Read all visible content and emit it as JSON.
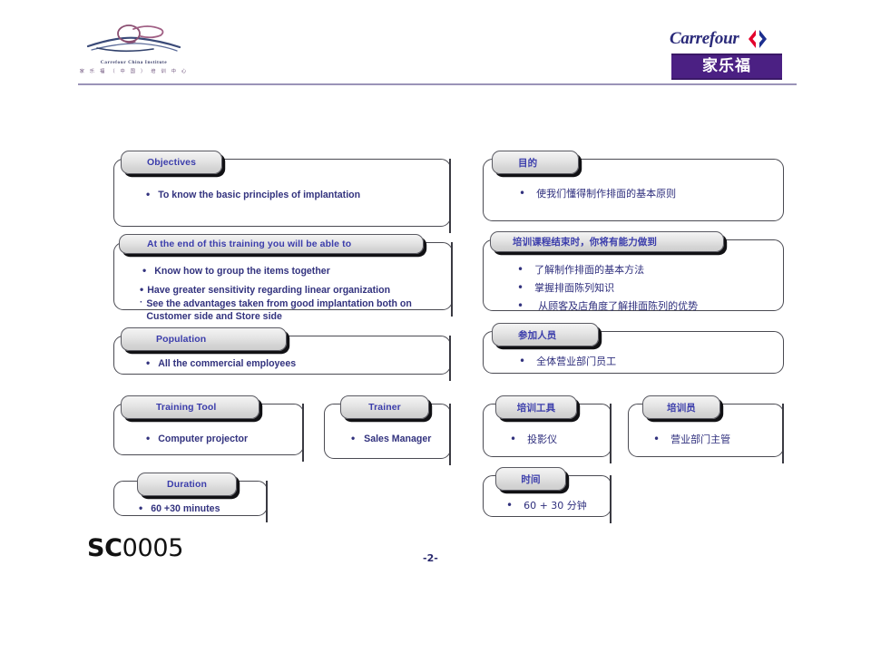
{
  "header": {
    "institute_logo": {
      "name_en": "Carrefour China Institute",
      "name_cn": "家 乐 福 （ 中 国 ） 培 训 中 心",
      "icon": "hand-holding-seedling-icon"
    },
    "carrefour_logo": {
      "wordmark": "Carrefour",
      "mark_icon": "carrefour-chevron-icon",
      "chinese_name": "家乐福"
    }
  },
  "left_column": [
    {
      "id": "objectives",
      "tab": "Objectives",
      "items": [
        "To know the basic principles of implantation"
      ]
    },
    {
      "id": "able-to",
      "tab": "At the end of this training you will be able to",
      "items": [
        "Know how to group the items together",
        "Have greater sensitivity regarding linear organization",
        "See the advantages taken from good implantation both on Customer side and Store side"
      ]
    },
    {
      "id": "population",
      "tab": "Population",
      "items": [
        "All the commercial employees"
      ]
    },
    {
      "id": "training-tool",
      "tab": "Training Tool",
      "items": [
        "Computer projector"
      ]
    },
    {
      "id": "trainer",
      "tab": "Trainer",
      "items": [
        "Sales Manager"
      ]
    },
    {
      "id": "duration",
      "tab": "Duration",
      "items": [
        "60 +30 minutes"
      ]
    }
  ],
  "right_column": [
    {
      "id": "objectives-cn",
      "tab": "目的",
      "items": [
        "使我们懂得制作排面的基本原则"
      ]
    },
    {
      "id": "able-to-cn",
      "tab": "培训课程结束时，你将有能力做到",
      "items": [
        "了解制作排面的基本方法",
        "掌握排面陈列知识",
        "从顾客及店角度了解排面陈列的优势"
      ]
    },
    {
      "id": "population-cn",
      "tab": "参加人员",
      "items": [
        "全体营业部门员工"
      ]
    },
    {
      "id": "training-tool-cn",
      "tab": "培训工具",
      "items": [
        "投影仪"
      ]
    },
    {
      "id": "trainer-cn",
      "tab": "培训员",
      "items": [
        "营业部门主管"
      ]
    },
    {
      "id": "duration-cn",
      "tab": "时间",
      "items": [
        "60 + 30 分钟"
      ]
    }
  ],
  "footer": {
    "doc_code_prefix": "SC",
    "doc_code_number": "0005",
    "page_number": "-2-"
  },
  "colors": {
    "heading_text": "#3b3dab",
    "body_text": "#32327e",
    "carrefour_purple": "#4b2083",
    "carrefour_blue": "#2a2a7a",
    "carrefour_red": "#e4002b",
    "rule": "#9a93b8",
    "box_border": "#4a4a52",
    "tab_shadow": "#111114"
  }
}
